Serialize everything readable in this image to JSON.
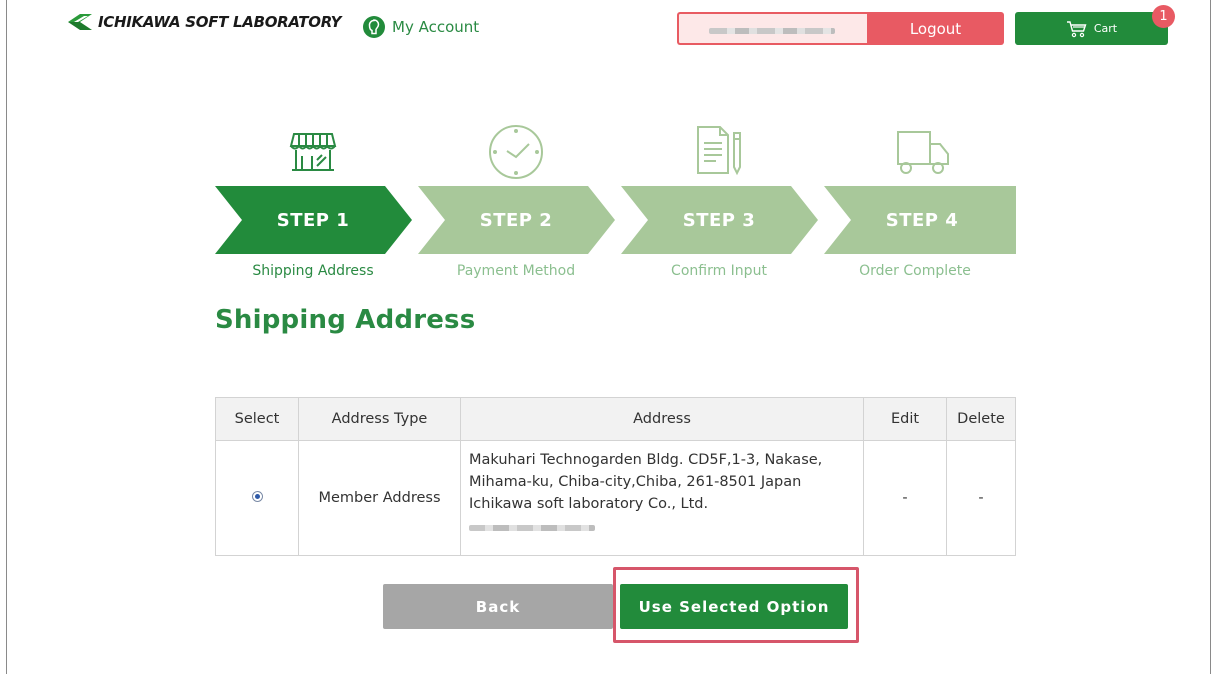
{
  "header": {
    "brand": "ICHIKAWA SOFT LABORATORY",
    "account_label": "My Account",
    "logout_label": "Logout",
    "cart_label": "Cart",
    "cart_count": "1"
  },
  "steps": [
    {
      "title": "STEP 1",
      "label": "Shipping Address",
      "icon": "storefront-icon",
      "state": "active"
    },
    {
      "title": "STEP 2",
      "label": "Payment Method",
      "icon": "clock-icon",
      "state": "inactive"
    },
    {
      "title": "STEP 3",
      "label": "Confirm Input",
      "icon": "document-pen-icon",
      "state": "inactive"
    },
    {
      "title": "STEP 4",
      "label": "Order Complete",
      "icon": "truck-icon",
      "state": "inactive"
    }
  ],
  "page_title": "Shipping Address",
  "table": {
    "headers": [
      "Select",
      "Address Type",
      "Address",
      "Edit",
      "Delete"
    ],
    "rows": [
      {
        "selected": true,
        "address_type": "Member Address",
        "address_lines": [
          "Makuhari Technogarden Bldg. CD5F,1-3, Nakase,",
          "Mihama-ku, Chiba-city,Chiba, 261-8501 Japan",
          "Ichikawa soft laboratory Co., Ltd."
        ],
        "edit": "-",
        "delete": "-"
      }
    ]
  },
  "actions": {
    "back_label": "Back",
    "use_selected_label": "Use Selected Option"
  },
  "colors": {
    "brand_green": "#228b3b",
    "step_inactive": "#a8c89a",
    "logout_red": "#e85a63",
    "highlight": "#d6566a"
  }
}
